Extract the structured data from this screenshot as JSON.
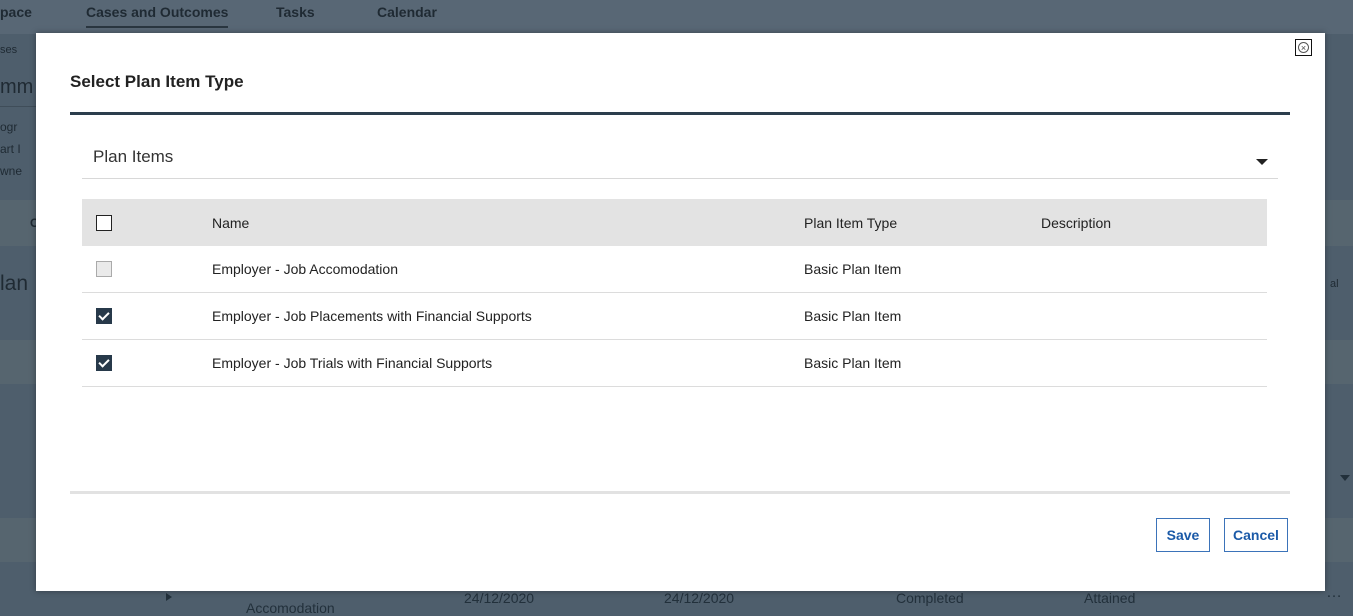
{
  "background": {
    "tabs": [
      "pace",
      "Cases and Outcomes",
      "Tasks",
      "Calendar"
    ],
    "side_fragments": [
      "ses",
      "mm",
      "ogr",
      "art I",
      "wne",
      "C",
      "lan"
    ],
    "right_fragment": "al",
    "row": {
      "name_line": "Accomodation",
      "start_date": "24/12/2020",
      "end_date": "24/12/2020",
      "status": "Completed",
      "outcome": "Attained",
      "more": "…"
    }
  },
  "modal": {
    "title": "Select Plan Item Type",
    "dropdown_label": "Plan Items",
    "columns": {
      "name": "Name",
      "type": "Plan Item Type",
      "description": "Description"
    },
    "rows": [
      {
        "name": "Employer - Job Accomodation",
        "type": "Basic Plan Item",
        "description": "",
        "state": "disabled"
      },
      {
        "name": "Employer - Job Placements with Financial Supports",
        "type": "Basic Plan Item",
        "description": "",
        "state": "checked"
      },
      {
        "name": "Employer - Job Trials with Financial Supports",
        "type": "Basic Plan Item",
        "description": "",
        "state": "checked"
      }
    ],
    "save_label": "Save",
    "cancel_label": "Cancel"
  },
  "icons": {
    "close": "close-circle-icon",
    "dropdown": "caret-down-icon",
    "check": "checkmark-icon"
  },
  "colors": {
    "header_rule": "#2c3e4d",
    "checkbox_checked": "#27394a",
    "button_text": "#1b5aa8",
    "button_border": "#3b73b9",
    "overlay": "#4e5e6c"
  }
}
